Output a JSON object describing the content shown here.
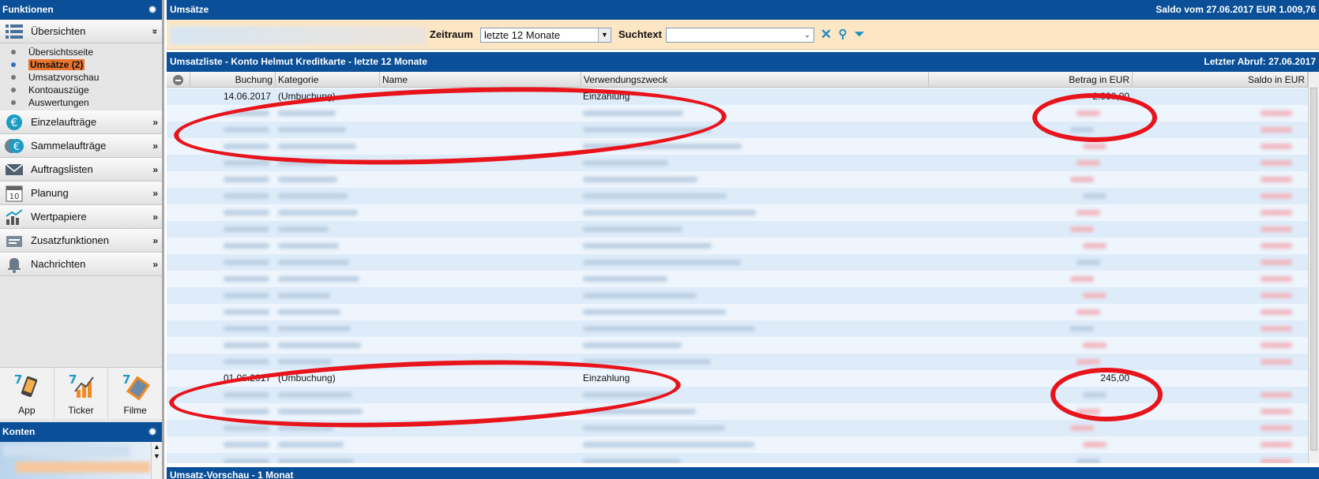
{
  "sidebar": {
    "title": "Funktionen",
    "groups": [
      {
        "label": "Übersichten",
        "chevron": "»",
        "icon": "list-icon"
      },
      {
        "label": "Einzelaufträge",
        "chevron": "»",
        "icon": "euro-icon"
      },
      {
        "label": "Sammelaufträge",
        "chevron": "»",
        "icon": "euro-stack-icon"
      },
      {
        "label": "Auftragslisten",
        "chevron": "»",
        "icon": "envelope-icon"
      },
      {
        "label": "Planung",
        "chevron": "»",
        "icon": "calendar-icon"
      },
      {
        "label": "Wertpapiere",
        "chevron": "»",
        "icon": "chart-icon"
      },
      {
        "label": "Zusatzfunktionen",
        "chevron": "»",
        "icon": "card-icon"
      },
      {
        "label": "Nachrichten",
        "chevron": "»",
        "icon": "bell-icon"
      }
    ],
    "subitems": [
      {
        "label": "Übersichtsseite"
      },
      {
        "label": "Umsätze (2)"
      },
      {
        "label": "Umsatzvorschau"
      },
      {
        "label": "Kontoauszüge"
      },
      {
        "label": "Auswertungen"
      }
    ],
    "apps": [
      {
        "label": "App",
        "icon": "phone-app-icon"
      },
      {
        "label": "Ticker",
        "icon": "ticker-app-icon"
      },
      {
        "label": "Filme",
        "icon": "film-app-icon"
      }
    ],
    "konten_title": "Konten"
  },
  "main": {
    "title": "Umsätze",
    "saldo": "Saldo vom 27.06.2017  EUR 1.009,76",
    "filter": {
      "zeitraum_label": "Zeitraum",
      "zeitraum_value": "letzte 12 Monate",
      "suchtext_label": "Suchtext",
      "suchtext_value": ""
    },
    "list": {
      "title": "Umsatzliste - Konto Helmut Kreditkarte - letzte 12 Monate",
      "last_fetch": "Letzter Abruf: 27.06.2017",
      "columns": [
        "Buchung",
        "Kategorie",
        "Name",
        "Verwendungszweck",
        "Betrag in EUR",
        "Saldo in EUR"
      ],
      "visible_rows": [
        {
          "buchung": "14.06.2017",
          "kategorie": "(Umbuchung)",
          "name": "",
          "zweck": "Einzahlung",
          "betrag": "2.000,00"
        },
        {
          "buchung": "01.06.2017",
          "kategorie": "(Umbuchung)",
          "name": "",
          "zweck": "Einzahlung",
          "betrag": "245,00"
        }
      ]
    },
    "bottom_title": "Umsatz-Vorschau - 1 Monat"
  },
  "colors": {
    "header_blue": "#0a4f97",
    "active_orange": "#e8742d",
    "annotation_red": "#e8141c",
    "filter_bg": "#fde6c4"
  }
}
